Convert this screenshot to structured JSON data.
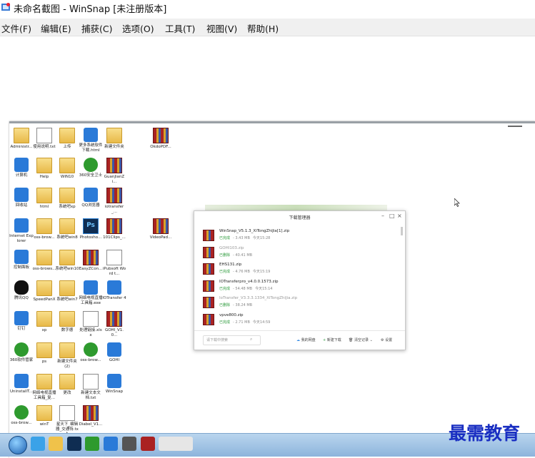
{
  "window": {
    "title": "未命名截图 - WinSnap  [未注册版本]"
  },
  "menu": [
    "文件(F)",
    "编辑(E)",
    "捕获(C)",
    "选项(O)",
    "工具(T)",
    "视图(V)",
    "帮助(H)"
  ],
  "desktop_icons": [
    {
      "label": "Administr...",
      "type": "user-folder-icon"
    },
    {
      "label": "使用说明.txt",
      "type": "text-file-icon"
    },
    {
      "label": "上传",
      "type": "folder-icon"
    },
    {
      "label": "更多系统软件下载.html",
      "type": "ie-icon"
    },
    {
      "label": "新建文件夹",
      "type": "folder-icon"
    },
    {
      "label": "OkdoPDF...",
      "type": "rar-icon"
    },
    {
      "label": "计算机",
      "type": "computer-icon"
    },
    {
      "label": "Help",
      "type": "folder-icon"
    },
    {
      "label": "WIN10",
      "type": "folder-icon"
    },
    {
      "label": "360安全卫士",
      "type": "360-icon"
    },
    {
      "label": "GuanJianZi...",
      "type": "rar-icon"
    },
    {
      "label": "回收站",
      "type": "recycle-bin-icon"
    },
    {
      "label": "html",
      "type": "folder-icon"
    },
    {
      "label": "系统吧xp",
      "type": "folder-icon"
    },
    {
      "label": "QQ浏览器",
      "type": "qq-browser-icon"
    },
    {
      "label": "iotransfer_...",
      "type": "rar-icon"
    },
    {
      "label": "Internet Explorer",
      "type": "ie-icon"
    },
    {
      "label": "oss-brow...",
      "type": "folder-icon"
    },
    {
      "label": "系统吧win8",
      "type": "folder-icon"
    },
    {
      "label": "Photosho...",
      "type": "photoshop-icon"
    },
    {
      "label": "101Clips_...",
      "type": "rar-icon"
    },
    {
      "label": "VideoPad...",
      "type": "rar-icon"
    },
    {
      "label": "控制面板",
      "type": "control-panel-icon"
    },
    {
      "label": "oss-brows...",
      "type": "folder-icon"
    },
    {
      "label": "系统吧win10",
      "type": "folder-icon"
    },
    {
      "label": "EasyZCon...",
      "type": "rar-icon"
    },
    {
      "label": "iPubsoft Word t...",
      "type": "word-icon"
    },
    {
      "label": "腾讯QQ",
      "type": "qq-icon"
    },
    {
      "label": "SpeedPanX",
      "type": "folder-icon"
    },
    {
      "label": "系统吧win7",
      "type": "folder-icon"
    },
    {
      "label": "网络电视直播工具箱.exe",
      "type": "exe-icon"
    },
    {
      "label": "IOTransfer 4",
      "type": "iotransfer-icon"
    },
    {
      "label": "钉钉",
      "type": "dingtalk-icon"
    },
    {
      "label": "xp",
      "type": "folder-icon"
    },
    {
      "label": "数字德",
      "type": "folder-icon"
    },
    {
      "label": "处理链接.xlsx",
      "type": "excel-icon"
    },
    {
      "label": "GOHI_V1.0...",
      "type": "rar-icon"
    },
    {
      "label": "360软件管家",
      "type": "360-manager-icon"
    },
    {
      "label": "ps",
      "type": "folder-icon"
    },
    {
      "label": "新建文件夹 (2)",
      "type": "folder-icon"
    },
    {
      "label": "oss-brow...",
      "type": "green-app-icon"
    },
    {
      "label": "GOHI",
      "type": "gohi-icon"
    },
    {
      "label": "UninstallT...",
      "type": "uninstall-icon"
    },
    {
      "label": "网络电视直播工具箱_复...",
      "type": "folder-icon"
    },
    {
      "label": "更改",
      "type": "folder-icon"
    },
    {
      "label": "新建文本文档.txt",
      "type": "text-file-icon"
    },
    {
      "label": "WinSnap",
      "type": "winsnap-icon"
    },
    {
      "label": "oss-brow...",
      "type": "green-app-icon"
    },
    {
      "label": "winT",
      "type": "folder-icon"
    },
    {
      "label": "星天下_编辑器_交通恃.txt",
      "type": "text-file-icon"
    },
    {
      "label": "Diabel_V1...",
      "type": "rar-icon"
    }
  ],
  "download_manager": {
    "title": "下载管理器",
    "items": [
      {
        "name": "WinSnap_V5.1.3_XiTongZhiJia[1].zip",
        "status": "已完成",
        "size": "3.43 MB",
        "time": "今天15:28",
        "dim": false
      },
      {
        "name": "GOHI103.zip",
        "status": "已删除",
        "size": "40.41 MB",
        "time": "",
        "dim": true
      },
      {
        "name": "EHS131.zip",
        "status": "已完成",
        "size": "4.76 MB",
        "time": "今天15:19",
        "dim": false
      },
      {
        "name": "IOTransferpro_v4.0.0.1573.zip",
        "status": "已完成",
        "size": "54.48 MB",
        "time": "今天15:14",
        "dim": false
      },
      {
        "name": "IoTransfer_V3.3.3.1334_XiTongZhiJia.zip",
        "status": "已删除",
        "size": "38.24 MB",
        "time": "",
        "dim": true
      },
      {
        "name": "vpve800.zip",
        "status": "已完成",
        "size": "2.71 MB",
        "time": "今天14:59",
        "dim": false
      }
    ],
    "search_placeholder": "请下载中搜索",
    "footer": {
      "cloud": "我的网盘",
      "new": "新建下载",
      "clear": "清空记录",
      "settings": "设置"
    }
  },
  "watermark": "最需教育"
}
